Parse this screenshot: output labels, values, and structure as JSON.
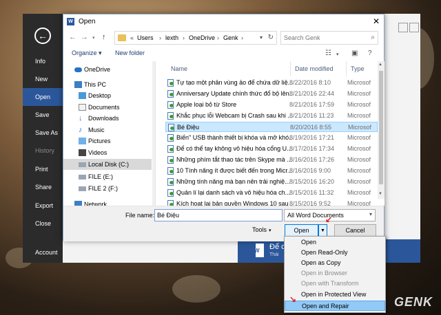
{
  "backstage": {
    "items": [
      "Info",
      "New",
      "Open",
      "Save",
      "Save As",
      "History",
      "Print",
      "Share",
      "Export",
      "Close",
      "Account"
    ],
    "active": "Open",
    "recent_doc": {
      "title": "Để c",
      "subtitle": "Thái"
    }
  },
  "dialog": {
    "title": "Open",
    "breadcrumbs": [
      "Users",
      "lexth",
      "OneDrive",
      "Genk"
    ],
    "search_placeholder": "Search Genk",
    "toolbar": {
      "organize": "Organize ▾",
      "new_folder": "New folder"
    },
    "nav": [
      {
        "label": "OneDrive",
        "icon": "cloud-icon"
      },
      {
        "label": "This PC",
        "icon": "computer-icon"
      },
      {
        "label": "Desktop",
        "icon": "desktop-icon"
      },
      {
        "label": "Documents",
        "icon": "documents-icon"
      },
      {
        "label": "Downloads",
        "icon": "downloads-icon"
      },
      {
        "label": "Music",
        "icon": "music-icon"
      },
      {
        "label": "Pictures",
        "icon": "pictures-icon"
      },
      {
        "label": "Videos",
        "icon": "videos-icon"
      },
      {
        "label": "Local Disk (C:)",
        "icon": "drive-icon"
      },
      {
        "label": "FILE (E:)",
        "icon": "drive-icon"
      },
      {
        "label": "FILE 2 (F:)",
        "icon": "drive-icon"
      },
      {
        "label": "Network",
        "icon": "network-icon"
      }
    ],
    "columns": {
      "name": "Name",
      "date": "Date modified",
      "type": "Type"
    },
    "files": [
      {
        "name": "Tự tạo một phân vùng ảo để chứa dữ liệ...",
        "date": "8/22/2016 8:10",
        "type": "Microsof"
      },
      {
        "name": "Anniversary Update chính thức đổ bộ lên...",
        "date": "8/21/2016 22:44",
        "type": "Microsof"
      },
      {
        "name": "Apple loại bỏ từ Store",
        "date": "8/21/2016 17:59",
        "type": "Microsof"
      },
      {
        "name": "Khắc phục lỗi Webcam bị Crash sau khi ...",
        "date": "8/21/2016 11:23",
        "type": "Microsof"
      },
      {
        "name": "Bé Điệu",
        "date": "8/20/2016 8:55",
        "type": "Microsof"
      },
      {
        "name": "Biến\" USB thành thiết bị khóa và mở khó...",
        "date": "8/19/2016 17:21",
        "type": "Microsof"
      },
      {
        "name": "Để có thể tay không vô hiệu hóa cổng U...",
        "date": "8/17/2016 17:34",
        "type": "Microsof"
      },
      {
        "name": "Những phím tắt thao tác trên Skype mà ...",
        "date": "8/16/2016 17:26",
        "type": "Microsof"
      },
      {
        "name": "10 Tính năng ít được biết đến trong Micr...",
        "date": "8/16/2016 9:00",
        "type": "Microsof"
      },
      {
        "name": "Những tính năng mà bạn nên trải nghiệ...",
        "date": "8/15/2016 16:20",
        "type": "Microsof"
      },
      {
        "name": "Quản lí lại danh sách và vô hiệu hóa ch...",
        "date": "8/15/2016 11:32",
        "type": "Microsof"
      },
      {
        "name": "Kích hoạt lại bản quyền Windows 10 sau ...",
        "date": "8/15/2016 9:52",
        "type": "Microsof"
      }
    ],
    "selected_file": "Bé Điệu",
    "file_name_label": "File name:",
    "file_name_value": "Bé Điệu",
    "file_type": "All Word Documents",
    "tools_label": "Tools",
    "open_label": "Open",
    "cancel_label": "Cancel"
  },
  "open_menu": {
    "items": [
      {
        "label": "Open",
        "disabled": false
      },
      {
        "label": "Open Read-Only",
        "disabled": false
      },
      {
        "label": "Open as Copy",
        "disabled": false
      },
      {
        "label": "Open in Browser",
        "disabled": true
      },
      {
        "label": "Open with Transform",
        "disabled": true
      },
      {
        "label": "Open in Protected View",
        "disabled": false
      },
      {
        "label": "Open and Repair",
        "disabled": false
      }
    ],
    "highlighted": "Open and Repair"
  },
  "watermark": "GENK",
  "colors": {
    "accent": "#2b579a",
    "selection": "#cce8ff",
    "menu_highlight": "#91c9f7",
    "arrow": "#e02020"
  }
}
